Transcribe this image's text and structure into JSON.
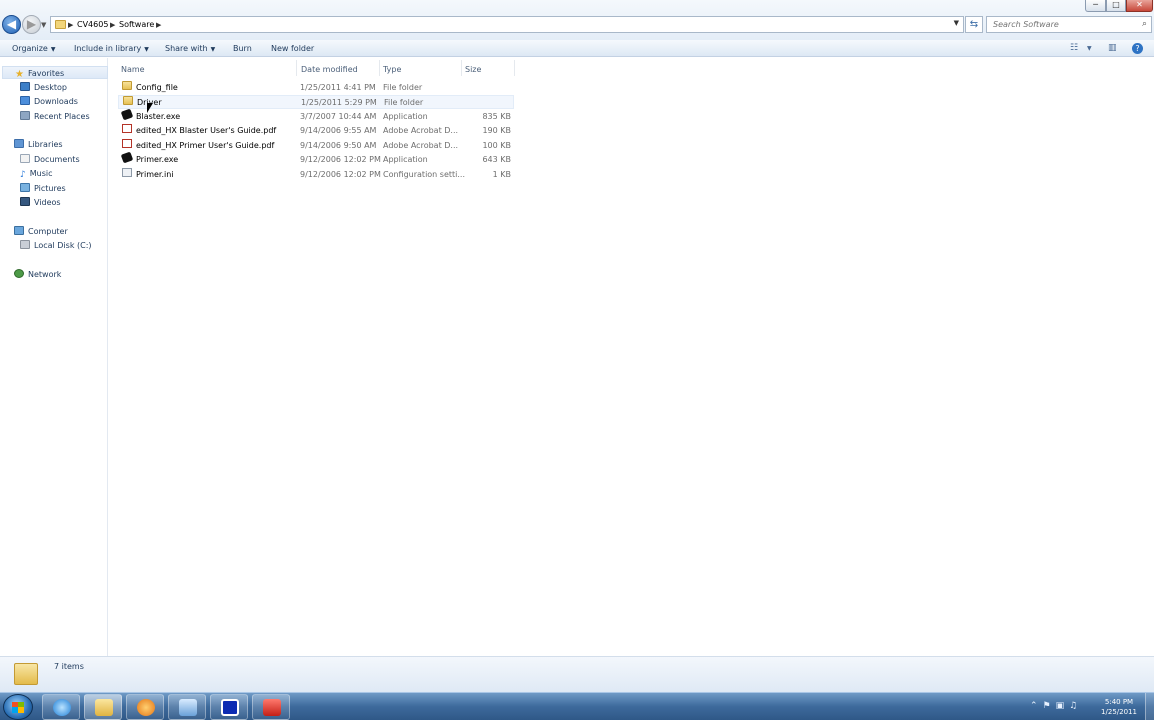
{
  "window": {
    "minimize_label": "─",
    "maximize_label": "□",
    "close_label": "✕"
  },
  "address": {
    "crumbs": [
      "CV4605",
      "Software"
    ],
    "search_placeholder": "Search Software"
  },
  "toolbar": {
    "organize": "Organize",
    "include_in_library": "Include in library",
    "share_with": "Share with",
    "burn": "Burn",
    "new_folder": "New folder"
  },
  "nav": {
    "favorites": "Favorites",
    "desktop": "Desktop",
    "downloads": "Downloads",
    "recent_places": "Recent Places",
    "libraries": "Libraries",
    "documents": "Documents",
    "music": "Music",
    "pictures": "Pictures",
    "videos": "Videos",
    "computer": "Computer",
    "local_disk": "Local Disk (C:)",
    "network": "Network"
  },
  "columns": {
    "name": "Name",
    "date_modified": "Date modified",
    "type": "Type",
    "size": "Size"
  },
  "files": [
    {
      "name": "Config_file",
      "date": "1/25/2011 4:41 PM",
      "type": "File folder",
      "size": "",
      "icon": "folder-icon"
    },
    {
      "name": "Driver",
      "date": "1/25/2011 5:29 PM",
      "type": "File folder",
      "size": "",
      "icon": "folder-icon"
    },
    {
      "name": "Blaster.exe",
      "date": "3/7/2007 10:44 AM",
      "type": "Application",
      "size": "835 KB",
      "icon": "application-icon"
    },
    {
      "name": "edited_HX Blaster User's Guide.pdf",
      "date": "9/14/2006 9:55 AM",
      "type": "Adobe Acrobat D...",
      "size": "190 KB",
      "icon": "pdf-icon"
    },
    {
      "name": "edited_HX Primer User's Guide.pdf",
      "date": "9/14/2006 9:50 AM",
      "type": "Adobe Acrobat D...",
      "size": "100 KB",
      "icon": "pdf-icon"
    },
    {
      "name": "Primer.exe",
      "date": "9/12/2006 12:02 PM",
      "type": "Application",
      "size": "643 KB",
      "icon": "application-icon"
    },
    {
      "name": "Primer.ini",
      "date": "9/12/2006 12:02 PM",
      "type": "Configuration setti...",
      "size": "1 KB",
      "icon": "settings-file-icon"
    }
  ],
  "status": {
    "item_count": "7 items"
  },
  "taskbar": {
    "time": "5:40 PM",
    "date": "1/25/2011"
  },
  "colors": {
    "accent": "#1e395b",
    "taskbar": "#3d6a9c"
  }
}
